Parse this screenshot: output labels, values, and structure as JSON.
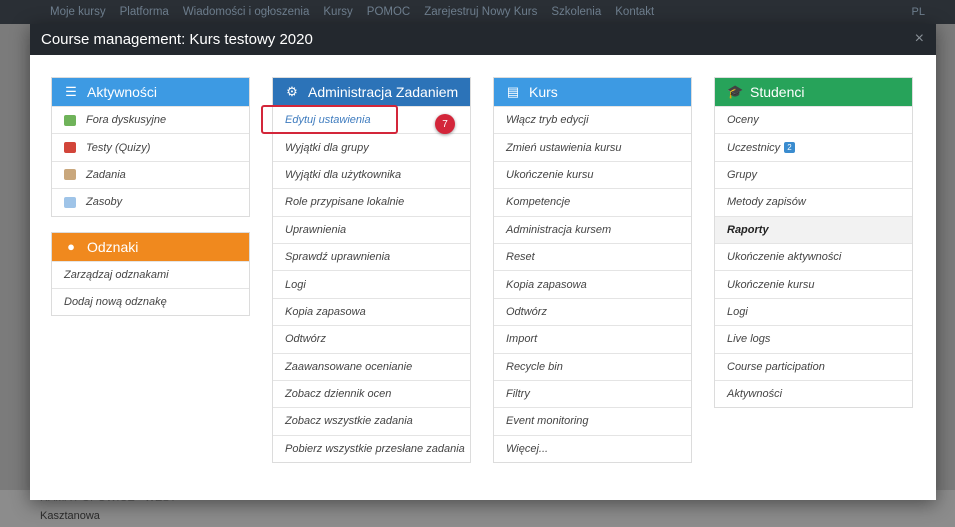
{
  "background": {
    "nav": [
      "Moje kursy",
      "Platforma",
      "Wiadomości i ogłoszenia",
      "Kursy",
      "POMOC",
      "Zarejestruj Nowy Kurs",
      "Szkolenia",
      "Kontakt"
    ],
    "lang": "PL",
    "bottom_line1": "RAMA POPOWICE - WEST",
    "bottom_line2": "Kasztanowa"
  },
  "modal": {
    "title": "Course management: Kurs testowy 2020",
    "close_label": "×"
  },
  "colors": {
    "aktywnosci": "#3d9ae3",
    "odznaki": "#f0891e",
    "administracja": "#2c73b8",
    "kurs": "#3d9ae3",
    "studenci": "#27a35a",
    "highlight": "#d3263a"
  },
  "panels": {
    "aktywnosci": {
      "title": "Aktywności",
      "icon": "list-icon",
      "items": [
        "Fora dyskusyjne",
        "Testy (Quizy)",
        "Zadania",
        "Zasoby"
      ]
    },
    "odznaki": {
      "title": "Odznaki",
      "icon": "badge-icon",
      "items": [
        "Zarządzaj odznakami",
        "Dodaj nową odznakę"
      ]
    },
    "administracja": {
      "title": "Administracja Zadaniem",
      "icon": "gears-icon",
      "items": [
        "Edytuj ustawienia",
        "Wyjątki dla grupy",
        "Wyjątki dla użytkownika",
        "Role przypisane lokalnie",
        "Uprawnienia",
        "Sprawdź uprawnienia",
        "Logi",
        "Kopia zapasowa",
        "Odtwórz",
        "Zaawansowane ocenianie",
        "Zobacz dziennik ocen",
        "Zobacz wszystkie zadania",
        "Pobierz wszystkie przesłane zadania"
      ]
    },
    "kurs": {
      "title": "Kurs",
      "icon": "book-icon",
      "items": [
        "Włącz tryb edycji",
        "Zmień ustawienia kursu",
        "Ukończenie kursu",
        "Kompetencje",
        "Administracja kursem",
        "Reset",
        "Kopia zapasowa",
        "Odtwórz",
        "Import",
        "Recycle bin",
        "Filtry",
        "Event monitoring",
        "Więcej..."
      ]
    },
    "studenci": {
      "title": "Studenci",
      "icon": "graduation-cap-icon",
      "items": [
        "Oceny",
        "Uczestnicy",
        "Grupy",
        "Metody zapisów",
        "Raporty",
        "Ukończenie aktywności",
        "Ukończenie kursu",
        "Logi",
        "Live logs",
        "Course participation",
        "Aktywności"
      ],
      "uczestnicy_badge": "2"
    }
  },
  "annotation": {
    "step_number": "7"
  }
}
